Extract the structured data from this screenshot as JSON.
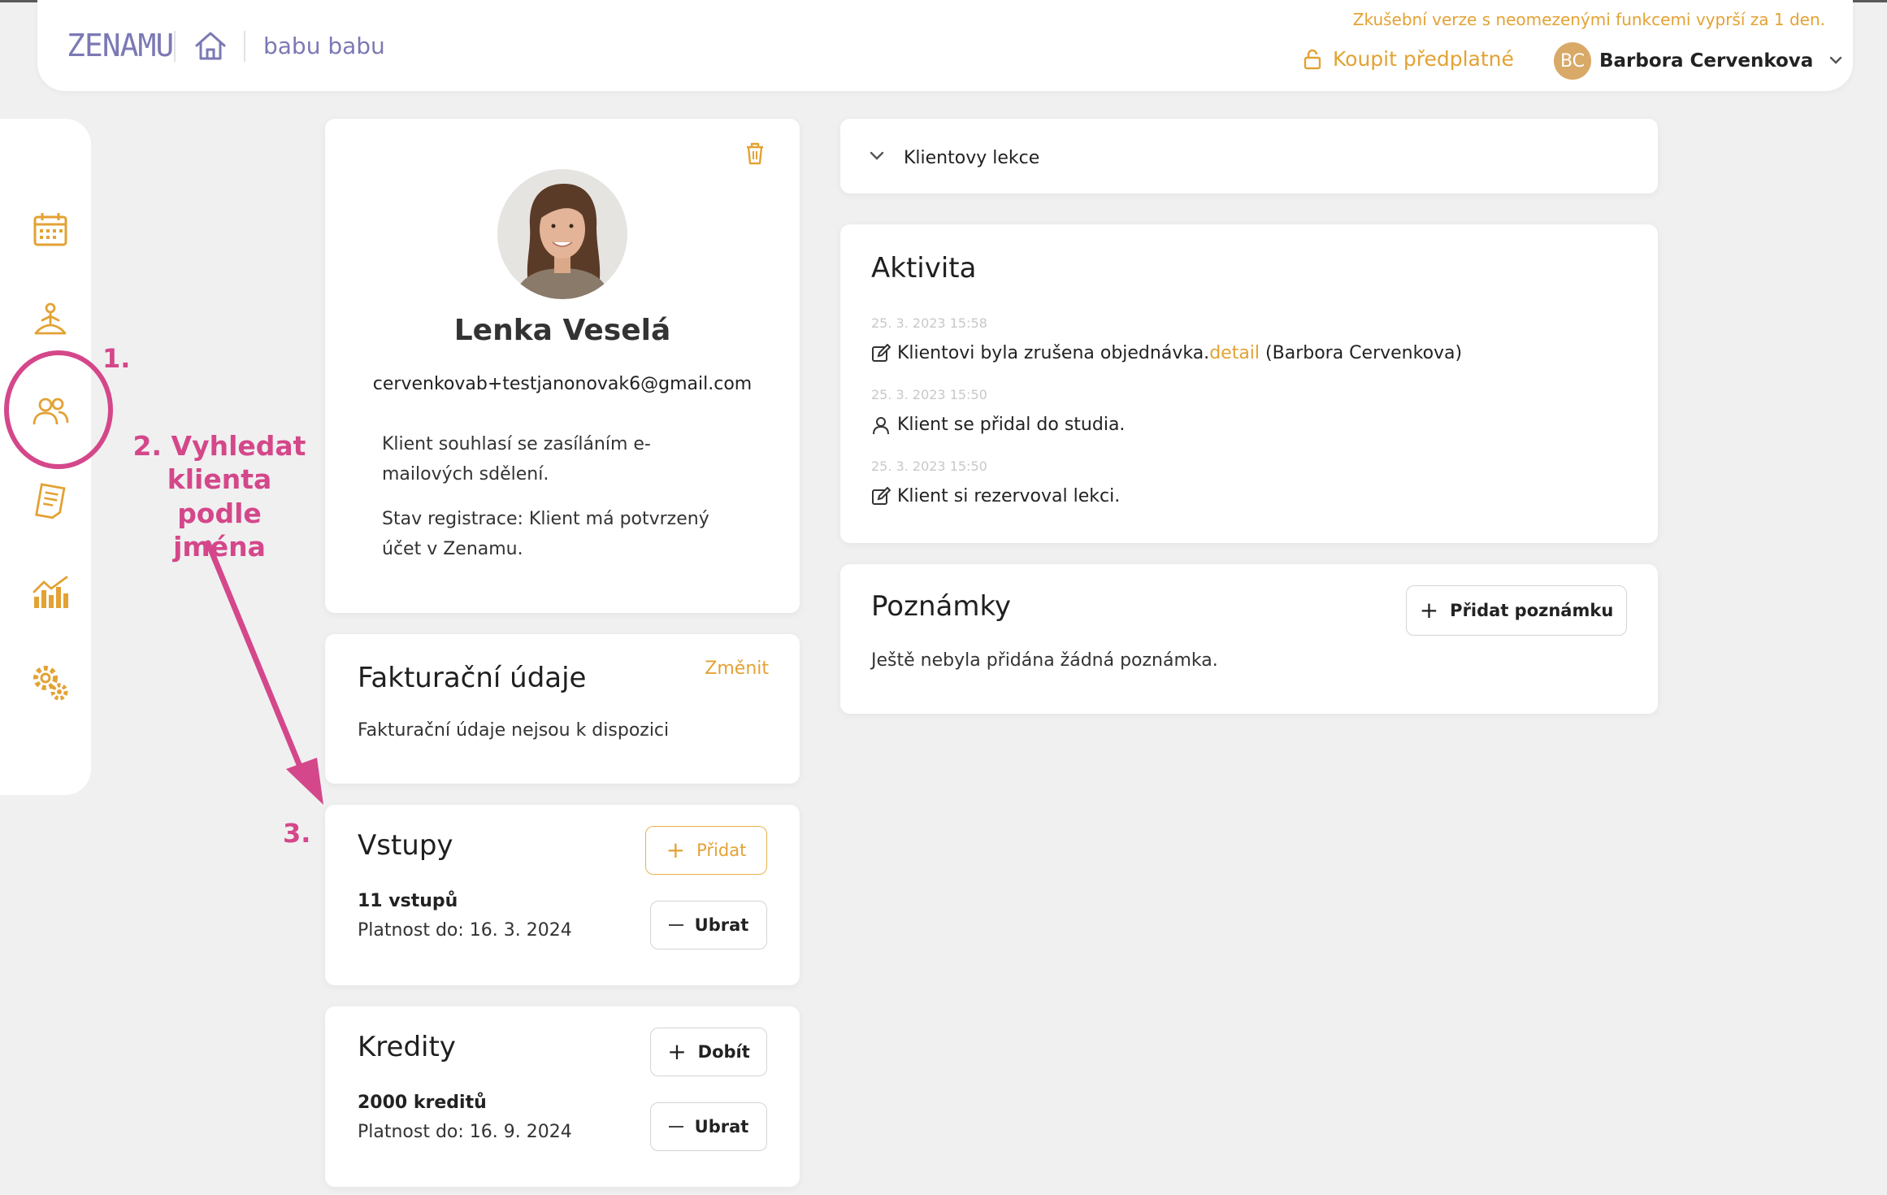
{
  "header": {
    "logo": "ZENAMU",
    "studio_name": "babu babu",
    "trial_notice": "Zkušební verze s neomezenými funkcemi vyprší za 1 den.",
    "buy_label": "Koupit předplatné",
    "user_initials": "BC",
    "user_name": "Barbora Cervenkova"
  },
  "colors": {
    "accent": "#e3a234",
    "brand": "#7b79b4",
    "annotation": "#d4478a"
  },
  "sidebar": {
    "items": [
      {
        "icon": "calendar-icon"
      },
      {
        "icon": "meditation-icon"
      },
      {
        "icon": "clients-icon"
      },
      {
        "icon": "documents-icon"
      },
      {
        "icon": "stats-icon"
      },
      {
        "icon": "settings-icon"
      }
    ]
  },
  "profile": {
    "name": "Lenka Veselá",
    "email": "cervenkovab+testjanonovak6@gmail.com",
    "consent_line1": "Klient souhlasí se zasíláním e-",
    "consent_line2": "mailových sdělení.",
    "status_line1": "Stav registrace: Klient má potvrzený",
    "status_line2": "účet v Zenamu."
  },
  "billing": {
    "title": "Fakturační údaje",
    "change_label": "Změnit",
    "empty_text": "Fakturační údaje nejsou k dispozici"
  },
  "entries": {
    "title": "Vstupy",
    "add_label": "Přidat",
    "remove_label": "Ubrat",
    "count": "11 vstupů",
    "validity": "Platnost do: 16. 3. 2024"
  },
  "credits": {
    "title": "Kredity",
    "topup_label": "Dobít",
    "remove_label": "Ubrat",
    "count": "2000 kreditů",
    "validity": "Platnost do: 16. 9. 2024"
  },
  "lessons": {
    "title": "Klientovy lekce"
  },
  "activity": {
    "title": "Aktivita",
    "items": [
      {
        "date": "25. 3. 2023 15:58",
        "text": "Klientovi byla zrušena objednávka.",
        "link": "detail",
        "suffix": "(Barbora Cervenkova)"
      },
      {
        "date": "25. 3. 2023 15:50",
        "text": "Klient se přidal do studia."
      },
      {
        "date": "25. 3. 2023 15:50",
        "text": "Klient si rezervoval lekci."
      }
    ]
  },
  "notes": {
    "title": "Poznámky",
    "add_label": "Přidat poznámku",
    "empty_text": "Ještě nebyla přidána žádná poznámka."
  },
  "annotations": {
    "step1": "1.",
    "step2_line1": "2. Vyhledat",
    "step2_line2": "klienta podle",
    "step2_line3": "jména",
    "step3": "3."
  }
}
